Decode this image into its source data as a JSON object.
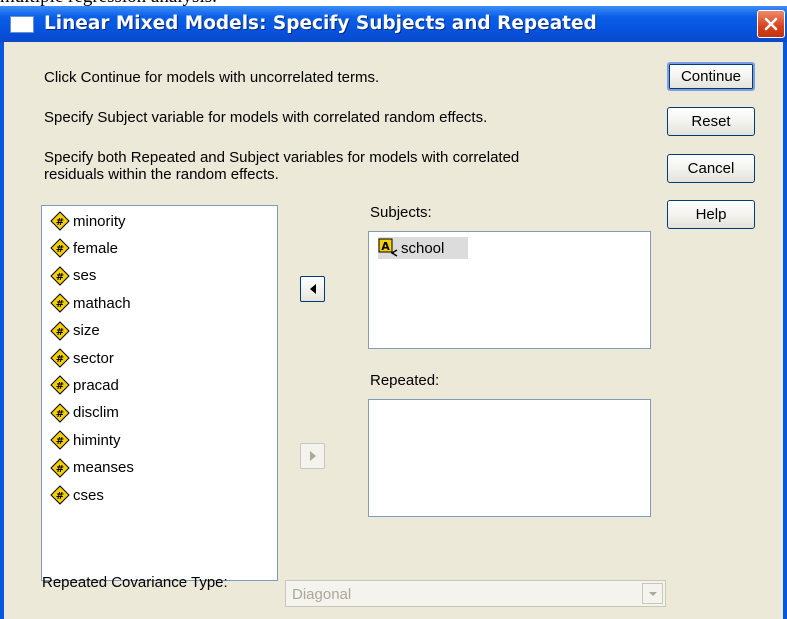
{
  "dialog": {
    "title": "Linear Mixed Models: Specify Subjects and Repeated",
    "instructions": [
      "Click Continue for models with uncorrelated terms.",
      "Specify Subject variable for models with correlated random effects.",
      "Specify both Repeated and Subject variables for models with correlated",
      "residuals within the random effects."
    ]
  },
  "buttons": {
    "continue": "Continue",
    "reset": "Reset",
    "cancel": "Cancel",
    "help": "Help"
  },
  "variables": [
    "minority",
    "female",
    "ses",
    "mathach",
    "size",
    "sector",
    "pracad",
    "disclim",
    "himinty",
    "meanses",
    "cses"
  ],
  "subjects": {
    "label": "Subjects:",
    "items": [
      "school"
    ]
  },
  "repeated": {
    "label": "Repeated:",
    "items": []
  },
  "covariance": {
    "label": "Repeated Covariance Type:",
    "selected": "Diagonal"
  },
  "colors": {
    "title_bar": "#0a56e0",
    "dialog_bg": "#ece9d8",
    "close_button": "#d9421a",
    "disabled_text": "#aca899",
    "scale_icon": "#f5d000"
  },
  "icons": {
    "scale_variable": "hash-scale-icon",
    "string_variable": "string-nominal-icon"
  }
}
